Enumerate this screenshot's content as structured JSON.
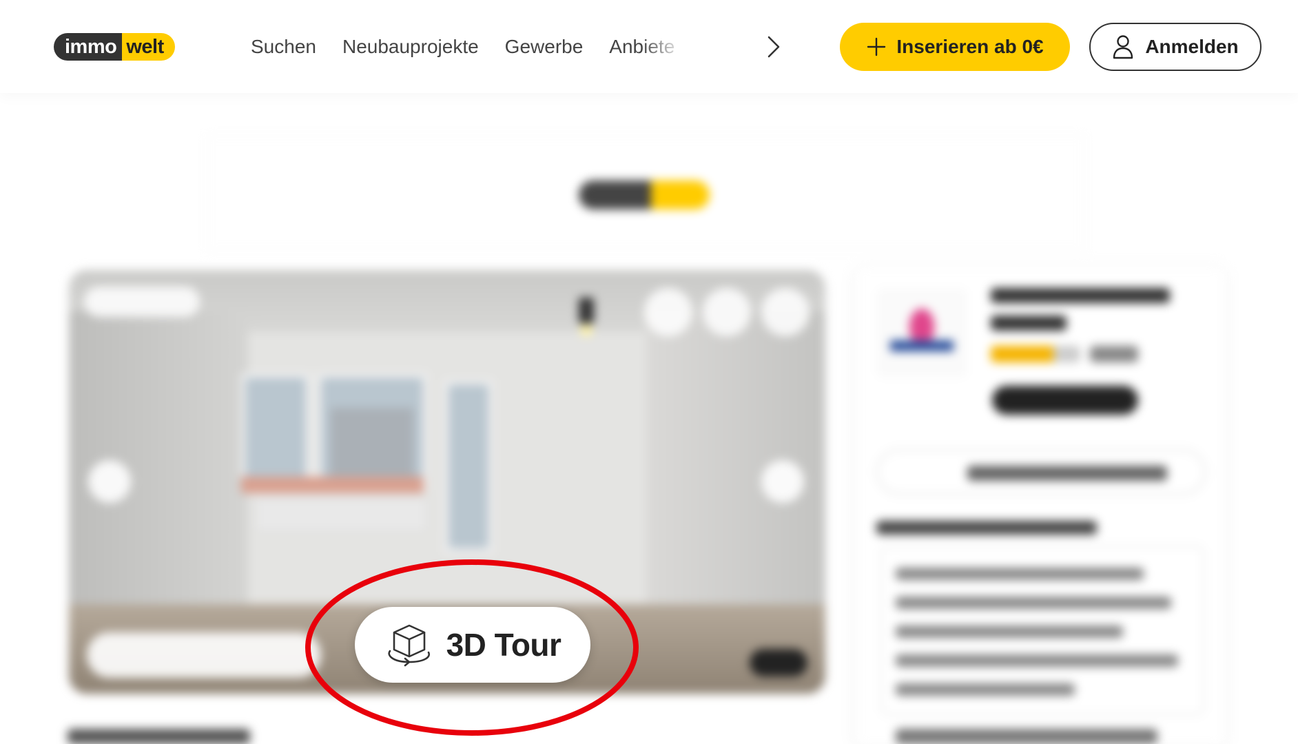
{
  "header": {
    "logo": {
      "left": "immo",
      "right": "welt"
    },
    "nav": [
      {
        "label": "Suchen"
      },
      {
        "label": "Neubauprojekte"
      },
      {
        "label": "Gewerbe"
      },
      {
        "label": "Anbiete"
      }
    ],
    "next_icon": "chevron-right-icon",
    "insert_button": {
      "label": "Inserieren ab 0€",
      "icon": "plus-icon"
    },
    "login_button": {
      "label": "Anmelden",
      "icon": "user-icon"
    }
  },
  "gallery": {
    "tour_button": {
      "label": "3D Tour",
      "icon": "cube-360-icon"
    }
  },
  "annotation": {
    "shape": "ellipse",
    "color": "#e8000b",
    "target": "tour_button"
  },
  "colors": {
    "brand_yellow": "#ffcc00",
    "brand_dark": "#333333"
  }
}
